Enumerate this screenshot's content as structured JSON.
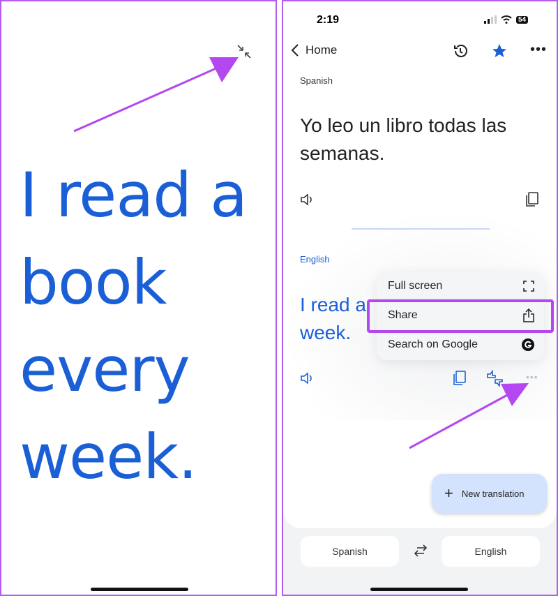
{
  "left": {
    "lines": [
      "I read a",
      "book",
      "every",
      "week."
    ],
    "exit_icon": "exit-fullscreen-icon"
  },
  "status": {
    "time": "2:19",
    "battery": "54"
  },
  "nav": {
    "back_label": "Home"
  },
  "source": {
    "language": "Spanish",
    "text": "Yo leo un libro todas las semanas."
  },
  "target": {
    "language": "English",
    "text_line1": "I read a",
    "text_line2": "week."
  },
  "menu": {
    "items": [
      {
        "label": "Full screen",
        "icon": "fullscreen-icon"
      },
      {
        "label": "Share",
        "icon": "share-icon"
      },
      {
        "label": "Search on Google",
        "icon": "google-icon"
      }
    ]
  },
  "fab": {
    "label": "New translation"
  },
  "bottom": {
    "source_lang": "Spanish",
    "target_lang": "English"
  },
  "colors": {
    "accent": "#1a5fd6",
    "annotation": "#b347f0",
    "fab": "#d3e3fd"
  }
}
